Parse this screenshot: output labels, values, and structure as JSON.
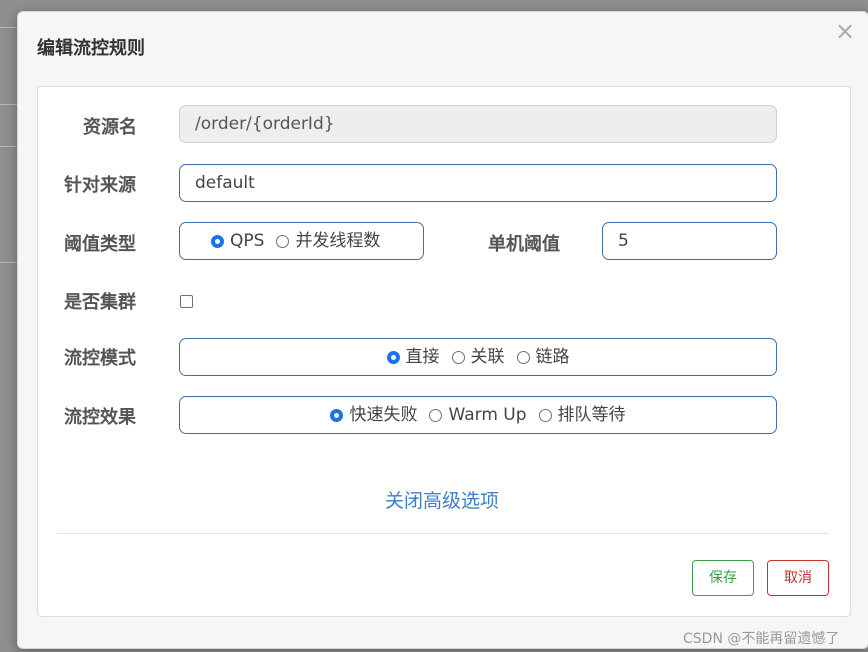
{
  "dialog": {
    "title": "编辑流控规则",
    "close_symbol": "×"
  },
  "form": {
    "resource": {
      "label": "资源名",
      "value": "/order/{orderId}"
    },
    "limit_app": {
      "label": "针对来源",
      "value": "default"
    },
    "grade": {
      "label": "阈值类型",
      "options": [
        "QPS",
        "并发线程数"
      ],
      "selected": "QPS"
    },
    "threshold": {
      "label": "单机阈值",
      "value": "5"
    },
    "cluster": {
      "label": "是否集群",
      "checked": false
    },
    "strategy": {
      "label": "流控模式",
      "options": [
        "直接",
        "关联",
        "链路"
      ],
      "selected": "直接"
    },
    "control_behavior": {
      "label": "流控效果",
      "options": [
        "快速失败",
        "Warm Up",
        "排队等待"
      ],
      "selected": "快速失败"
    },
    "advanced_toggle": "关闭高级选项"
  },
  "footer": {
    "save_label": "保存",
    "cancel_label": "取消"
  },
  "watermark": "CSDN @不能再留遗憾了",
  "colors": {
    "primary": "#1a73e8",
    "border": "#3c6fa8",
    "link": "#3d7fc1",
    "save": "#3a9d47",
    "cancel": "#c9302c"
  }
}
